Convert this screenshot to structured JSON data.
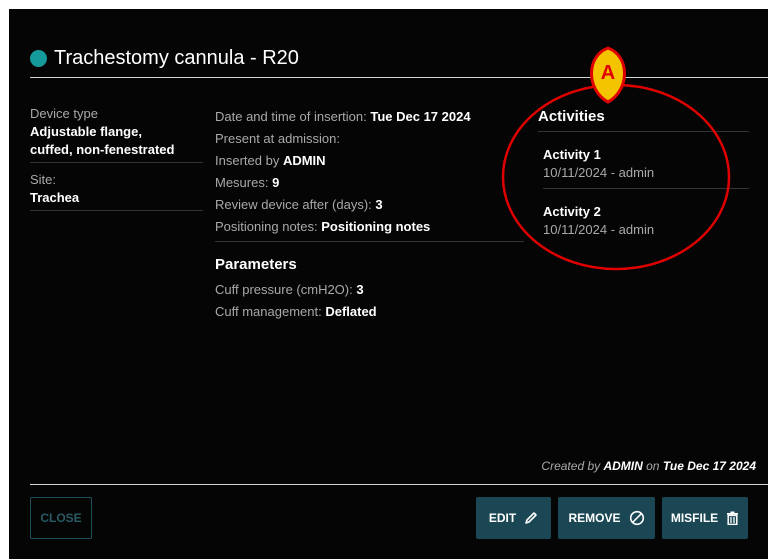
{
  "header": {
    "title": "Trachestomy cannula - R20",
    "status_color": "#159a9c"
  },
  "left": {
    "device_type_label": "Device type",
    "device_type_line1": "Adjustable flange,",
    "device_type_line2": "cuffed, non-fenestrated",
    "site_label": "Site:",
    "site_value": "Trachea"
  },
  "details": {
    "insertion_label": "Date and time of insertion: ",
    "insertion_value": "Tue Dec 17 2024",
    "present_label": "Present at admission:",
    "inserted_label": "Inserted by ",
    "inserted_value": "ADMIN",
    "mesures_label": "Mesures: ",
    "mesures_value": "9",
    "review_label": "Review device after (days): ",
    "review_value": "3",
    "notes_label": "Positioning notes: ",
    "notes_value": "Positioning notes"
  },
  "parameters": {
    "heading": "Parameters",
    "cuff_pressure_label": "Cuff pressure (cmH2O): ",
    "cuff_pressure_value": "3",
    "cuff_mgmt_label": "Cuff management: ",
    "cuff_mgmt_value": "Deflated"
  },
  "activities": {
    "heading": "Activities",
    "items": [
      {
        "name": "Activity 1",
        "meta": "10/11/2024 - admin"
      },
      {
        "name": "Activity 2",
        "meta": "10/11/2024 - admin"
      }
    ]
  },
  "annotation": {
    "marker_label": "A",
    "color": "#e00000",
    "marker_fill": "#f5c400"
  },
  "footer": {
    "created_prefix": "Created by ",
    "created_user": "ADMIN",
    "created_mid": " on ",
    "created_date": "Tue Dec 17 2024",
    "close_label": "CLOSE",
    "edit_label": "EDIT",
    "remove_label": "REMOVE",
    "misfile_label": "MISFILE",
    "edit_icon": "pencil-icon",
    "remove_icon": "prohibited-icon",
    "misfile_icon": "trash-icon"
  }
}
